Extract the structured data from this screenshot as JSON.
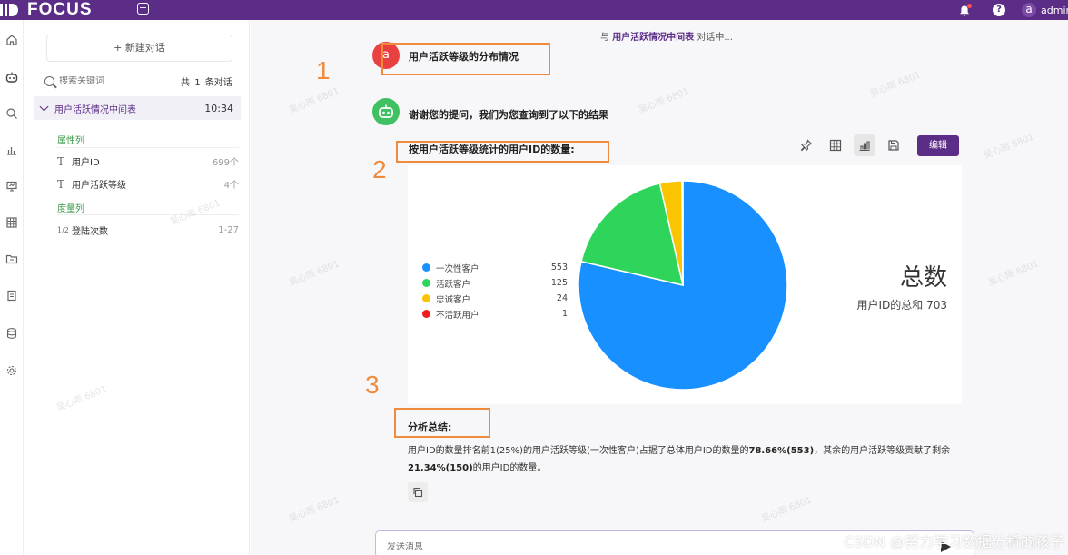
{
  "app": {
    "logo_text": "FOCUS",
    "user_avatar_letter": "a",
    "user_name": "admin"
  },
  "panel": {
    "new_chat_label": "+ 新建对话",
    "search_placeholder": "搜索关键词",
    "count_prefix": "共",
    "count_value": "1",
    "count_suffix": "条对话",
    "conversation": {
      "title": "用户活跃情况中间表",
      "time": "10:34"
    },
    "attributes_label": "属性列",
    "attributes": [
      {
        "name": "用户ID",
        "value": "699个"
      },
      {
        "name": "用户活跃等级",
        "value": "4个"
      }
    ],
    "measures_label": "度量列",
    "measures": [
      {
        "name": "登陆次数",
        "value": "1-27"
      }
    ]
  },
  "main": {
    "title_prefix": "与",
    "title_highlight": "用户活跃情况中间表",
    "title_suffix": "对话中...",
    "question_avatar": "a",
    "question": "用户活跃等级的分布情况",
    "answer": "谢谢您的提问，我们为您查询到了以下的结果",
    "chart_title": "按用户活跃等级统计的用户ID的数量:",
    "edit_label": "编辑",
    "total_title": "总数",
    "total_sub": "用户ID的总和 703",
    "summary_title": "分析总结:",
    "summary_part1": "用户ID的数量排名前1(25%)的用户活跃等级(一次性客户)占据了总体用户ID的数量的",
    "summary_bold1": "78.66%(553)",
    "summary_part2": "，其余的用户活跃等级贡献了剩余",
    "summary_bold2": "21.34%(150)",
    "summary_part3": "的用户ID的数量。",
    "input_placeholder": "发送消息"
  },
  "annotations": {
    "step1": "1",
    "step2": "2",
    "step3": "3"
  },
  "watermark_text": "吴心雨 6801",
  "csdn_credit": "CSDN @努力学习数据分析的孩子",
  "colors": {
    "brand": "#5b2d86",
    "highlight_box": "#f08a3c"
  },
  "chart_data": {
    "type": "pie",
    "title": "按用户活跃等级统计的用户ID的数量:",
    "categories": [
      "一次性客户",
      "活跃客户",
      "忠诚客户",
      "不活跃用户"
    ],
    "values": [
      553,
      125,
      24,
      1
    ],
    "colors": [
      "#1890ff",
      "#2fd45a",
      "#fcc400",
      "#f21a1a"
    ],
    "legend": "left"
  }
}
